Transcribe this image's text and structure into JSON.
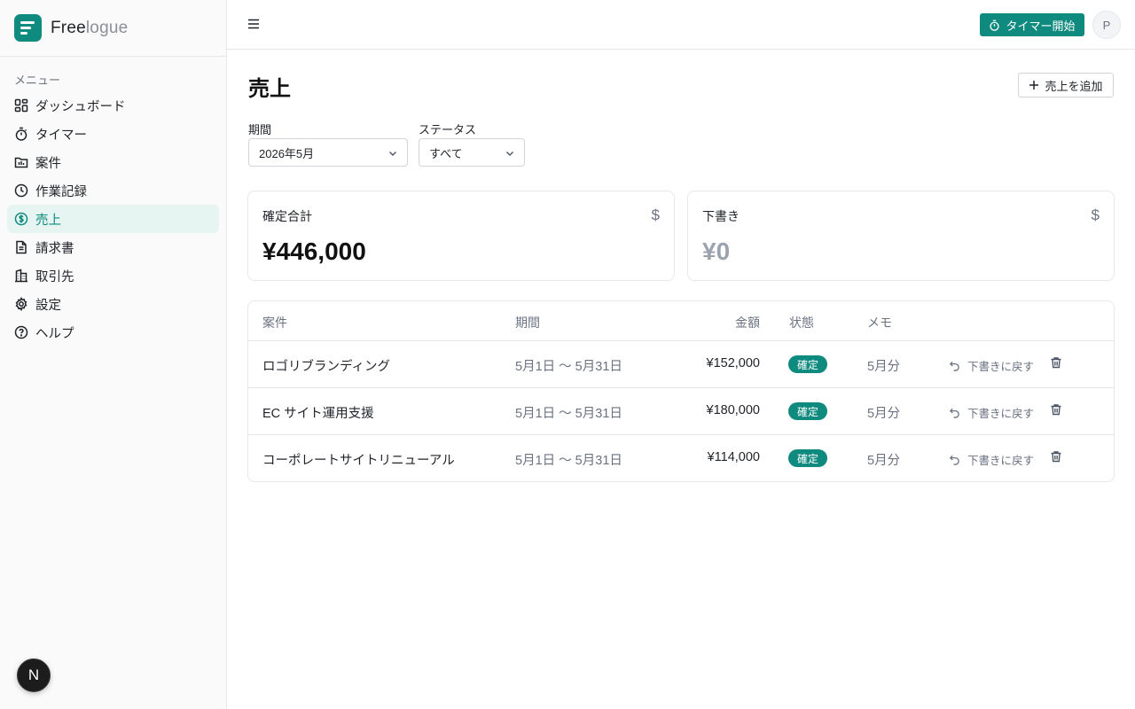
{
  "brand": {
    "name_strong": "Free",
    "name_light": "logue"
  },
  "sidebar": {
    "menu_label": "メニュー",
    "items": [
      {
        "label": "ダッシュボード",
        "icon": "dashboard-icon"
      },
      {
        "label": "タイマー",
        "icon": "timer-icon"
      },
      {
        "label": "案件",
        "icon": "folder-icon"
      },
      {
        "label": "作業記録",
        "icon": "clock-icon"
      },
      {
        "label": "売上",
        "icon": "dollar-circle-icon",
        "active": true
      },
      {
        "label": "請求書",
        "icon": "document-icon"
      },
      {
        "label": "取引先",
        "icon": "building-icon"
      },
      {
        "label": "設定",
        "icon": "gear-icon"
      },
      {
        "label": "ヘルプ",
        "icon": "help-circle-icon"
      }
    ],
    "badge_letter": "N"
  },
  "topbar": {
    "timer_button_label": "タイマー開始",
    "avatar_letter": "P"
  },
  "page": {
    "title": "売上",
    "add_button_label": "売上を追加"
  },
  "filters": {
    "period_label": "期間",
    "period_value": "2026年5月",
    "status_label": "ステータス",
    "status_value": "すべて"
  },
  "cards": {
    "confirmed": {
      "title": "確定合計",
      "icon_glyph": "$",
      "value": "¥446,000"
    },
    "draft": {
      "title": "下書き",
      "icon_glyph": "$",
      "value": "¥0"
    }
  },
  "table": {
    "headers": {
      "project": "案件",
      "period": "期間",
      "amount": "金額",
      "status": "状態",
      "memo": "メモ"
    },
    "rows": [
      {
        "project": "ロゴリブランディング",
        "period": "5月1日 〜 5月31日",
        "amount": "¥152,000",
        "status": "確定",
        "memo": "5月分",
        "action": "下書きに戻す"
      },
      {
        "project": "EC サイト運用支援",
        "period": "5月1日 〜 5月31日",
        "amount": "¥180,000",
        "status": "確定",
        "memo": "5月分",
        "action": "下書きに戻す"
      },
      {
        "project": "コーポレートサイトリニューアル",
        "period": "5月1日 〜 5月31日",
        "amount": "¥114,000",
        "status": "確定",
        "memo": "5月分",
        "action": "下書きに戻す"
      }
    ]
  },
  "colors": {
    "accent": "#0f8a7e",
    "accent_bg": "#e6f5f2",
    "muted_text": "#6b7280",
    "border": "#e5e7eb"
  }
}
